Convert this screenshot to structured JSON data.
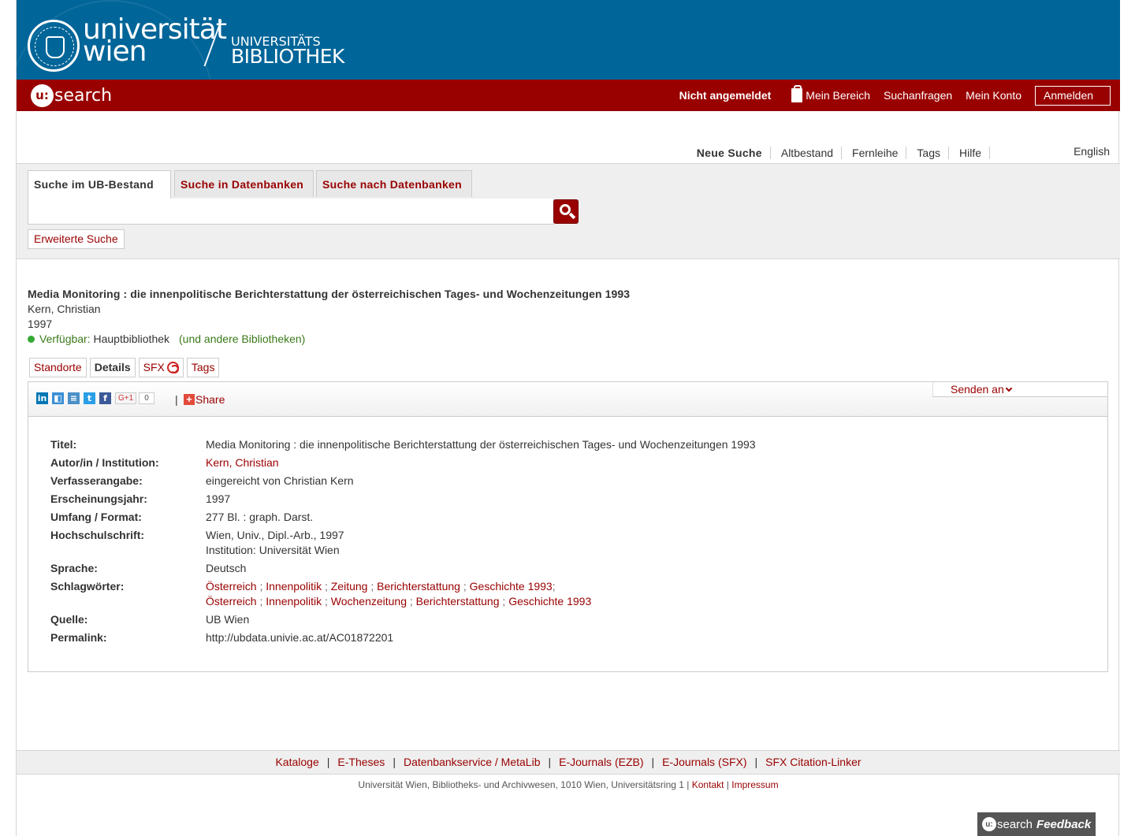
{
  "header": {
    "logo_uni_line1": "universität",
    "logo_uni_line2": "wien",
    "logo_ub_line1": "UNIVERSITÄTS",
    "logo_ub_line2": "BIBLIOTHEK",
    "usearch_u": "u:",
    "usearch_text": "search",
    "status": "Nicht angemeldet",
    "nav": [
      "Mein Bereich",
      "Suchanfragen",
      "Mein Konto"
    ],
    "login_label": "Anmelden",
    "colors": {
      "banner": "#006599",
      "redbar": "#990000"
    }
  },
  "secondary_nav": {
    "items": [
      "Neue Suche",
      "Altbestand",
      "Fernleihe",
      "Tags",
      "Hilfe"
    ],
    "language": "English"
  },
  "search": {
    "tabs": [
      "Suche im UB-Bestand",
      "Suche in Datenbanken",
      "Suche nach Datenbanken"
    ],
    "query": "",
    "advanced_label": "Erweiterte Suche",
    "button_icon": "search-icon"
  },
  "record": {
    "title": "Media Monitoring : die innenpolitische Berichterstattung der österreichischen Tages- und Wochenzeitungen 1993",
    "author": "Kern, Christian",
    "year": "1997",
    "availability_label": "Verfügbar:",
    "availability_library": "Hauptbibliothek",
    "availability_other": "(und andere Bibliotheken)",
    "tabs": [
      "Standorte",
      "Details",
      "SFX",
      "Tags"
    ],
    "share_label": "Share",
    "share_count": "0",
    "gplus_label": "G+1",
    "send_to_label": "Senden an",
    "details": {
      "titel_label": "Titel:",
      "titel": "Media Monitoring : die innenpolitische Berichterstattung der österreichischen Tages- und Wochenzeitungen 1993",
      "autor_label": "Autor/in / Institution:",
      "autor": "Kern, Christian",
      "verfasser_label": "Verfasserangabe:",
      "verfasser": "eingereicht von Christian Kern",
      "jahr_label": "Erscheinungsjahr:",
      "jahr": "1997",
      "umfang_label": "Umfang / Format:",
      "umfang": "277 Bl. : graph. Darst.",
      "hochschul_label": "Hochschulschrift:",
      "hochschul_line1": "Wien, Univ., Dipl.-Arb., 1997",
      "hochschul_line2": "Institution: Universität Wien",
      "sprache_label": "Sprache:",
      "sprache": "Deutsch",
      "schlag_label": "Schlagwörter:",
      "schlag_row1": [
        "Österreich",
        "Innenpolitik",
        "Zeitung",
        "Berichterstattung",
        "Geschichte 1993"
      ],
      "schlag_row2": [
        "Österreich",
        "Innenpolitik",
        "Wochenzeitung",
        "Berichterstattung",
        "Geschichte 1993"
      ],
      "quelle_label": "Quelle:",
      "quelle": "UB Wien",
      "permalink_label": "Permalink:",
      "permalink": "http://ubdata.univie.ac.at/AC01872201"
    }
  },
  "footer": {
    "links": [
      "Kataloge",
      "E-Theses",
      "Datenbankservice / MetaLib",
      "E-Journals (EZB)",
      "E-Journals (SFX)",
      "SFX Citation-Linker"
    ],
    "address": "Universität Wien, Bibliotheks- und Archivwesen, 1010 Wien, Universitätsring 1 |",
    "kontakt": "Kontakt",
    "impressum": "Impressum",
    "feedback_u": "u:",
    "feedback_search": "search",
    "feedback_label": "Feedback"
  }
}
